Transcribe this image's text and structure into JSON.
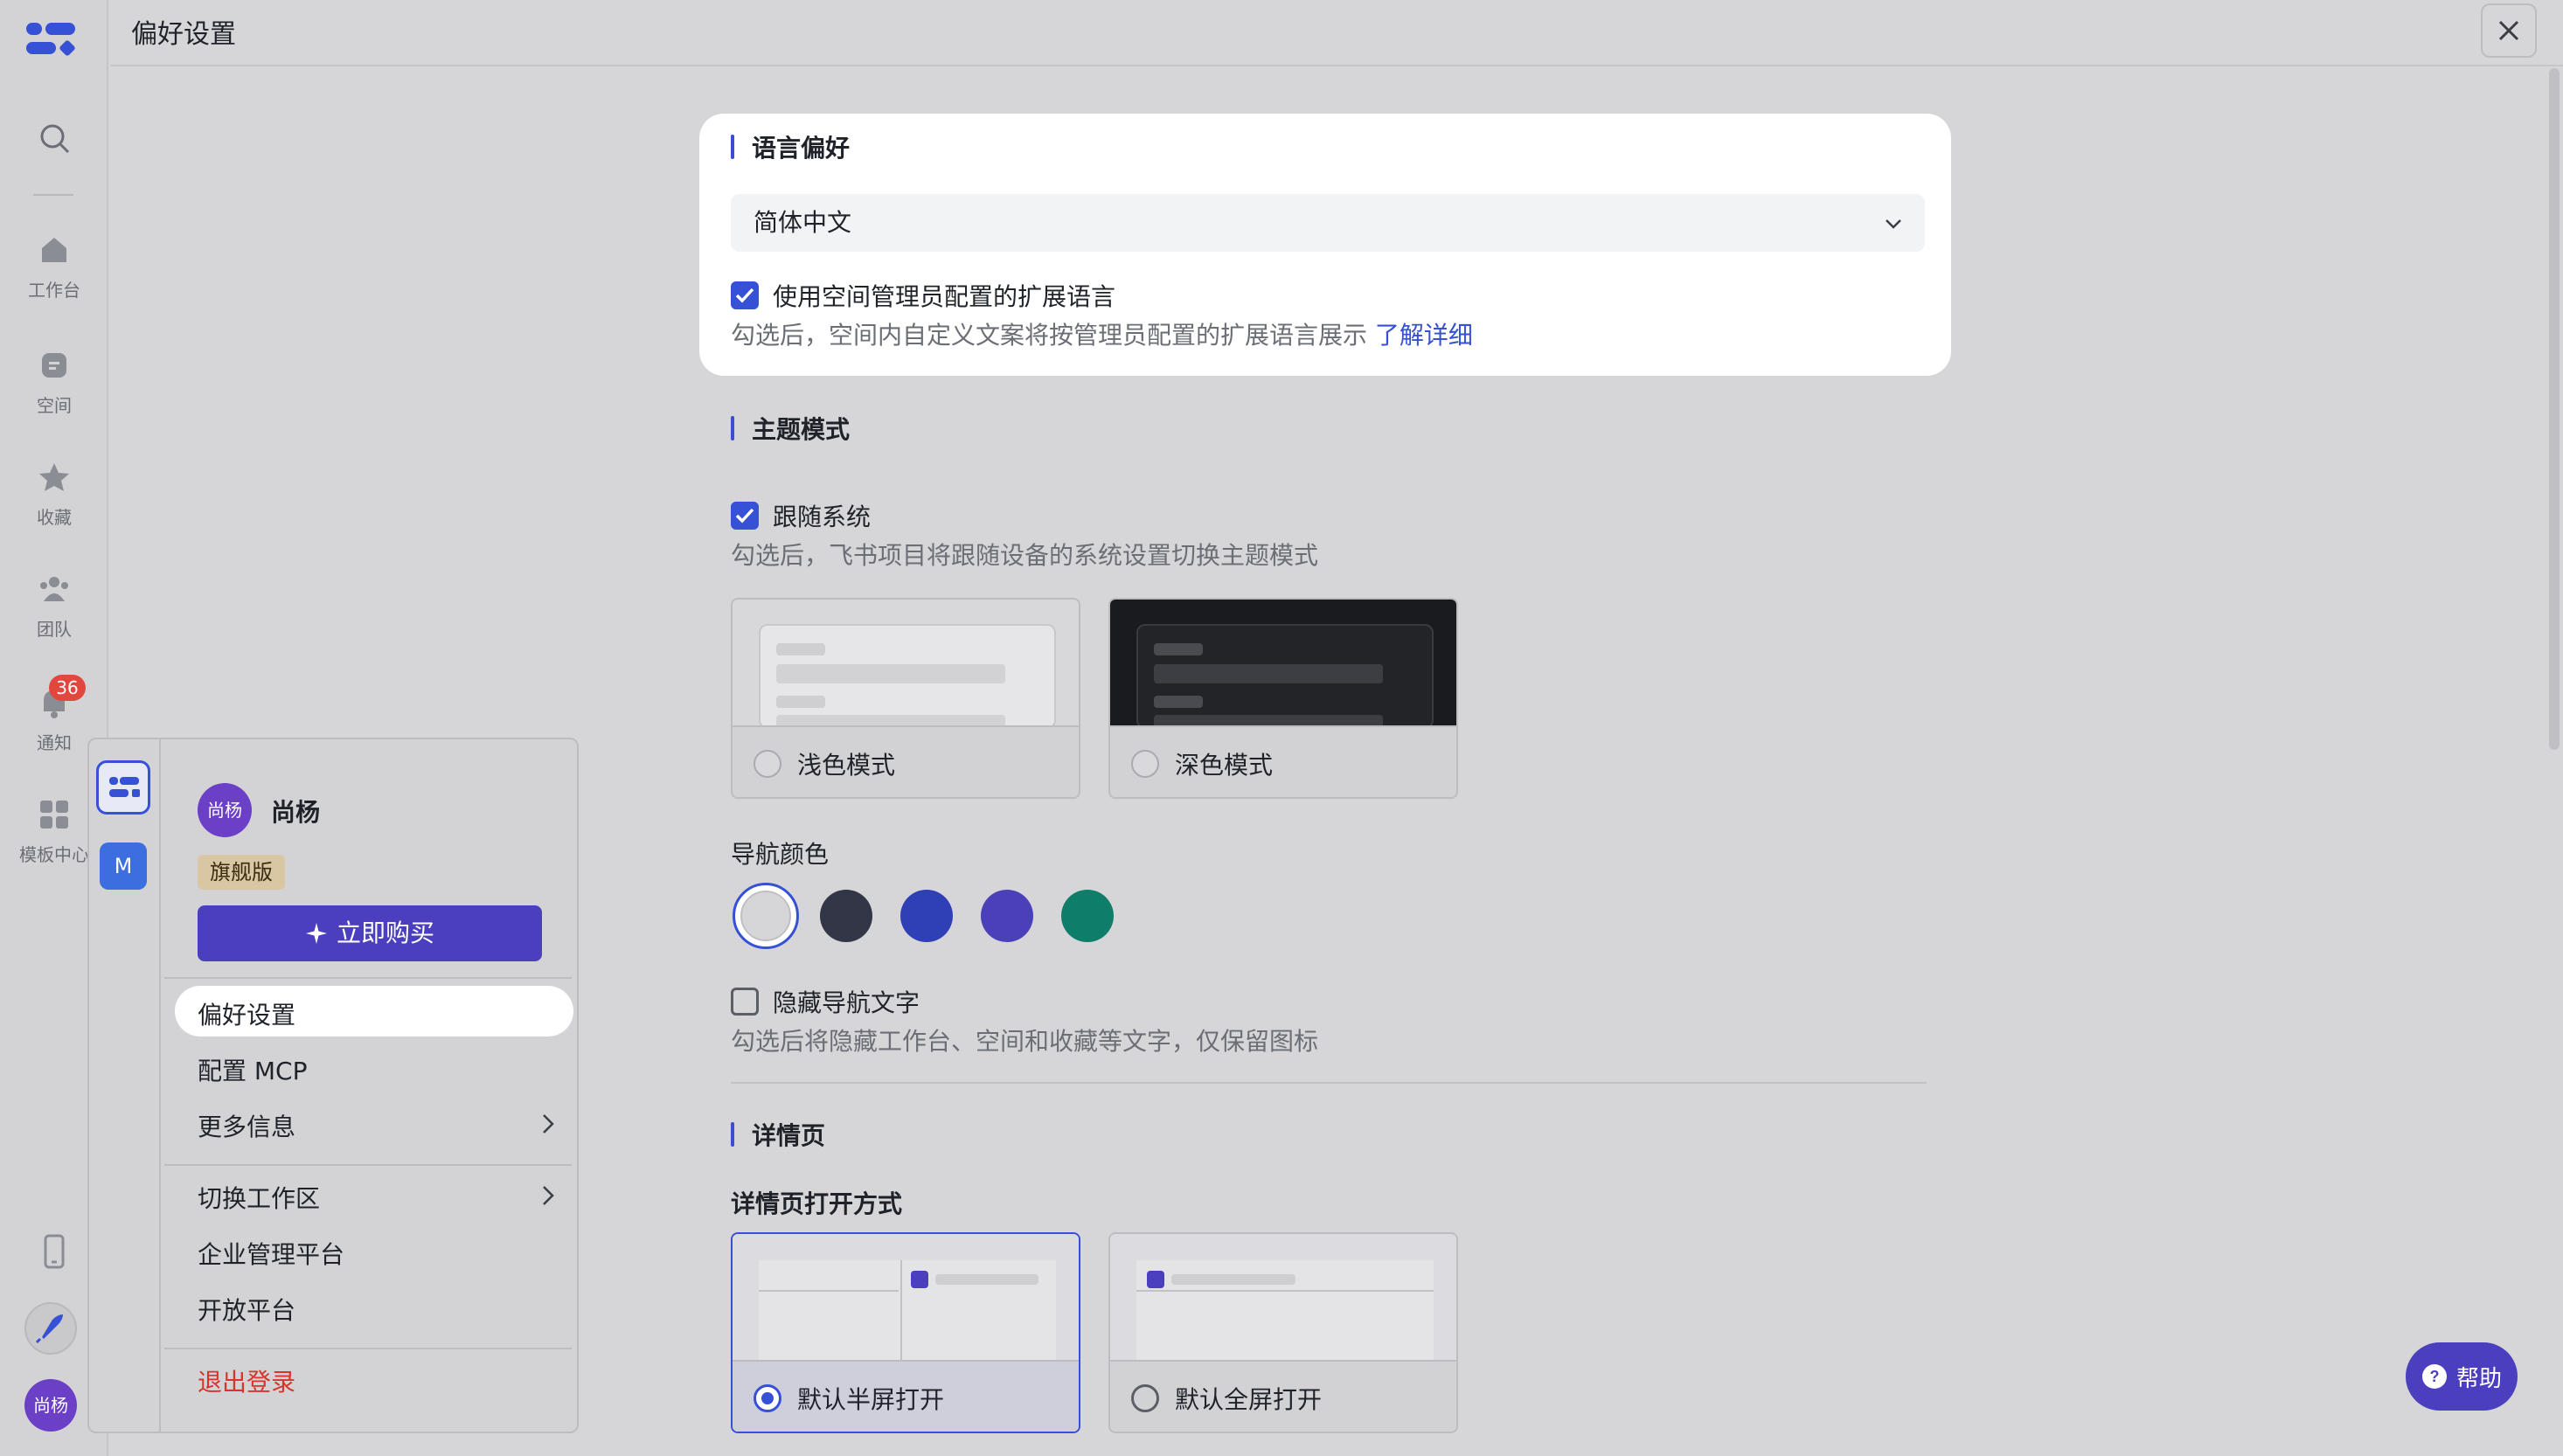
{
  "header": {
    "title": "偏好设置"
  },
  "rail": {
    "items": [
      {
        "label": "工作台"
      },
      {
        "label": "空间"
      },
      {
        "label": "收藏"
      },
      {
        "label": "团队"
      },
      {
        "label": "通知"
      },
      {
        "label": "模板中心"
      }
    ],
    "notification_count": "36",
    "avatar_text": "尚杨"
  },
  "language": {
    "section_title": "语言偏好",
    "selected": "简体中文",
    "ext_checkbox_label": "使用空间管理员配置的扩展语言",
    "ext_checked": true,
    "ext_hint": "勾选后，空间内自定义文案将按管理员配置的扩展语言展示",
    "ext_link": "了解详细"
  },
  "theme": {
    "section_title": "主题模式",
    "follow_label": "跟随系统",
    "follow_checked": true,
    "follow_hint": "勾选后，飞书项目将跟随设备的系统设置切换主题模式",
    "light_label": "浅色模式",
    "dark_label": "深色模式"
  },
  "nav": {
    "title": "导航颜色",
    "colors": [
      "#ffffff",
      "#333646",
      "#2f3fb6",
      "#4a40b8",
      "#0e7e6a"
    ],
    "selected_index": 0,
    "hide_text_label": "隐藏导航文字",
    "hide_text_checked": false,
    "hide_text_hint": "勾选后将隐藏工作台、空间和收藏等文字，仅保留图标"
  },
  "detail": {
    "section_title": "详情页",
    "open_title": "详情页打开方式",
    "half_label": "默认半屏打开",
    "full_label": "默认全屏打开",
    "selected": "half"
  },
  "popup": {
    "workspace2_initial": "M",
    "user_avatar": "尚杨",
    "user_name": "尚杨",
    "tier": "旗舰版",
    "buy_label": "立即购买",
    "items": [
      {
        "label": "偏好设置"
      },
      {
        "label": "配置 MCP"
      },
      {
        "label": "更多信息"
      },
      {
        "label": "切换工作区"
      },
      {
        "label": "企业管理平台"
      },
      {
        "label": "开放平台"
      },
      {
        "label": "退出登录"
      }
    ]
  },
  "help": {
    "label": "帮助"
  }
}
